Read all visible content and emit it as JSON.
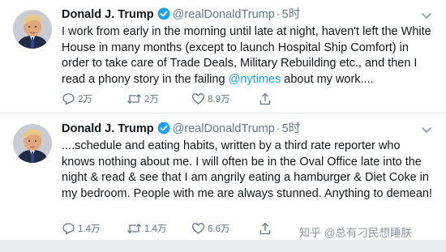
{
  "tweets": [
    {
      "name": "Donald J. Trump",
      "handle": "@realDonaldTrump",
      "separator": "·",
      "time": "5时",
      "text_before": "I work from early in the morning until late at night, haven't left the White House in many months (except to launch Hospital Ship Comfort) in order to take care of Trade Deals, Military Rebuilding etc., and then I read a phony story in the failing ",
      "mention": "@nytimes",
      "text_after": " about my work....",
      "replies": "2万",
      "retweets": "2万",
      "likes": "8.9万"
    },
    {
      "name": "Donald J. Trump",
      "handle": "@realDonaldTrump",
      "separator": "·",
      "time": "5时",
      "text_before": "....schedule and eating habits, written by a third rate reporter who knows nothing about me. I will often be in the Oval Office late into the night & read & see that I am angrily eating a hamburger & Diet Coke in my bedroom. People with me are always stunned. Anything to demean!",
      "mention": "",
      "text_after": "",
      "replies": "1.4万",
      "retweets": "1.4万",
      "likes": "6.6万"
    }
  ],
  "watermark": "知乎 @总有刁民想睡朕",
  "colors": {
    "accent": "#1da1f2",
    "secondary_text": "#657786",
    "divider": "#e6ecf0"
  },
  "icons": [
    "avatar",
    "verified-badge-icon",
    "chevron-down-icon",
    "reply-icon",
    "retweet-icon",
    "like-icon",
    "share-icon"
  ]
}
